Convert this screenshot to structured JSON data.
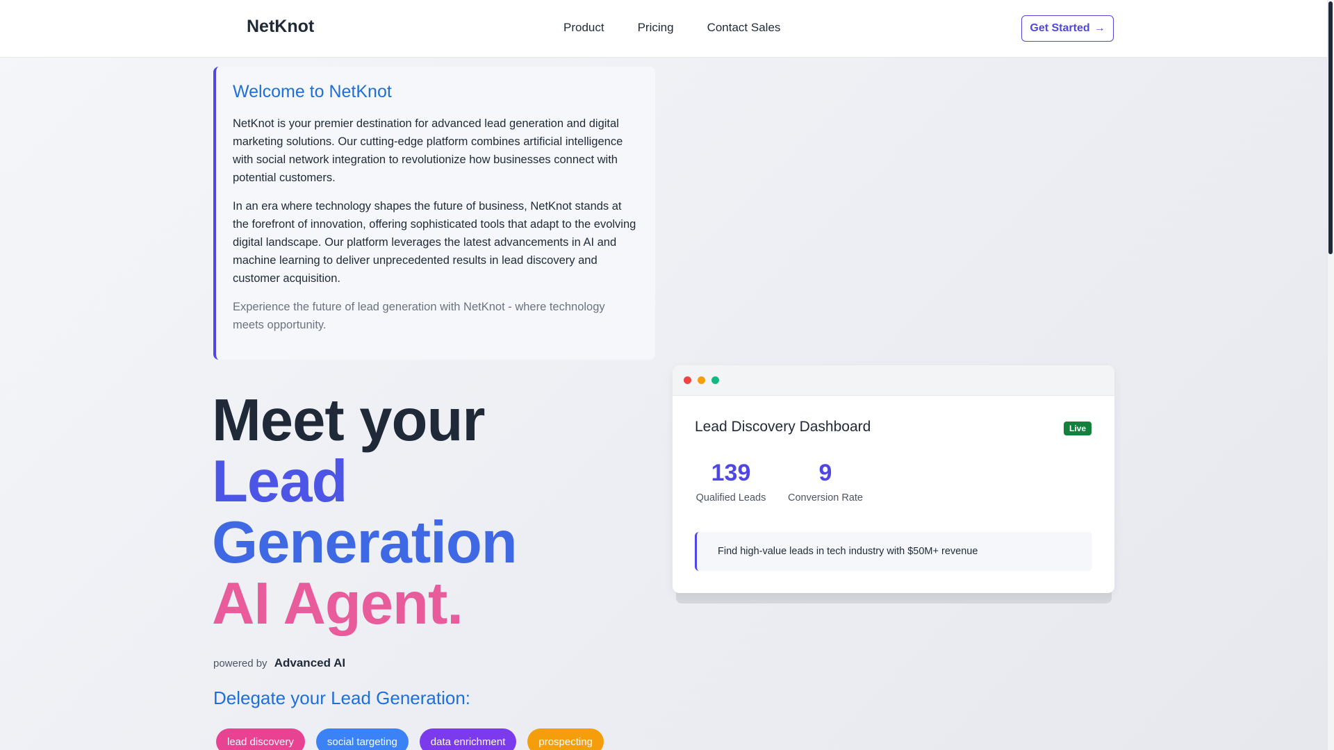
{
  "header": {
    "logo": "NetKnot",
    "nav": [
      "Product",
      "Pricing",
      "Contact Sales"
    ],
    "cta_label": "Get Started",
    "cta_icon": "arrow-right-icon"
  },
  "welcome": {
    "title": "Welcome to NetKnot",
    "paragraphs": [
      "NetKnot is your premier destination for advanced lead generation and digital marketing solutions. Our cutting-edge platform combines artificial intelligence with social network integration to revolutionize how businesses connect with potential customers.",
      "In an era where technology shapes the future of business, NetKnot stands at the forefront of innovation, offering sophisticated tools that adapt to the evolving digital landscape. Our platform leverages the latest advancements in AI and machine learning to deliver unprecedented results in lead discovery and customer acquisition."
    ],
    "tagline": "Experience the future of lead generation with NetKnot - where technology meets opportunity."
  },
  "hero": {
    "line1": "Meet your",
    "line2": "Lead",
    "line3": "Generation",
    "line4": "AI Agent.",
    "powered_prefix": "powered by",
    "powered_name": "Advanced AI",
    "delegate": "Delegate your Lead Generation:",
    "tags": [
      {
        "label": "lead discovery",
        "color": "#e84393"
      },
      {
        "label": "social targeting",
        "color": "#3b82f6"
      },
      {
        "label": "data enrichment",
        "color": "#7c3aed"
      },
      {
        "label": "prospecting",
        "color": "#f59e0b"
      }
    ]
  },
  "dashboard": {
    "window_dots": [
      "#ef4444",
      "#f59e0b",
      "#10b981"
    ],
    "title": "Lead Discovery Dashboard",
    "badge": "Live",
    "stats": [
      {
        "value": "139",
        "label": "Qualified Leads"
      },
      {
        "value": "9",
        "label": "Conversion Rate"
      }
    ],
    "query": "Find high-value leads in tech industry with $50M+ revenue"
  },
  "colors": {
    "accent": "#4f46e5",
    "link_blue": "#1e6fd9",
    "live_green": "#15803d"
  }
}
